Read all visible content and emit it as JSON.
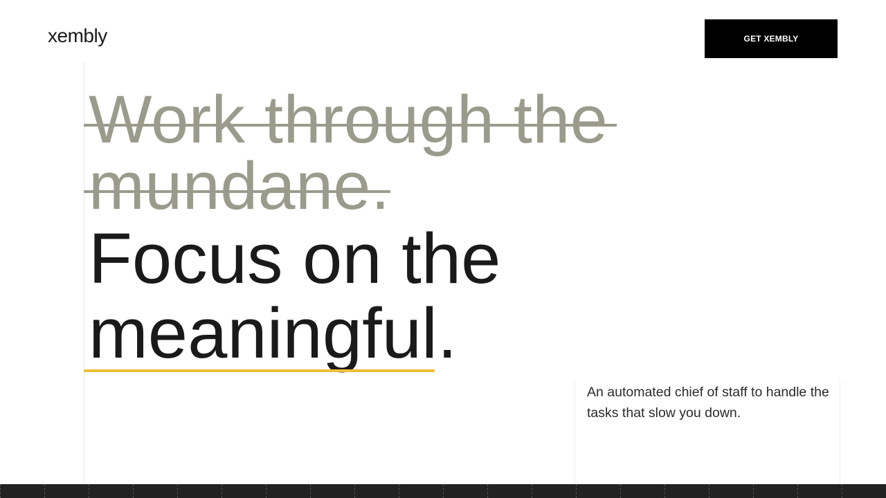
{
  "header": {
    "logo_text": "xembly",
    "cta_label": "GET XEMBLY"
  },
  "hero": {
    "struck_line_1": "Work through the",
    "struck_line_2": "mundane.",
    "focus_line_1": "Focus on the",
    "focus_line_2": "meaningful.",
    "description": "An automated chief of staff to handle the tasks that slow you down."
  },
  "colors": {
    "struck_text": "#9b9b8d",
    "accent_underline": "#f0be3c",
    "cta_background": "#000000",
    "footer_bar": "#222222"
  }
}
